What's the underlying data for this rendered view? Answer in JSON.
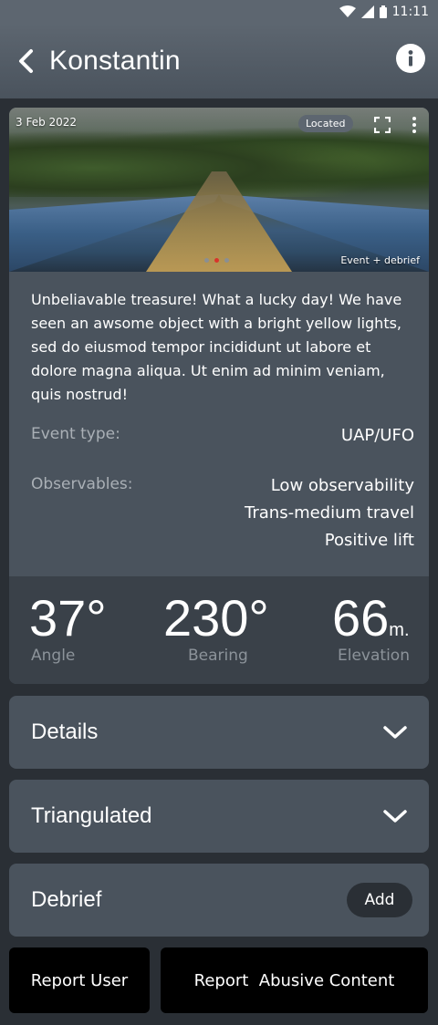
{
  "status_bar": {
    "time": "11:11",
    "icons": [
      "wifi-icon",
      "signal-icon",
      "battery-icon"
    ]
  },
  "header": {
    "title": "Konstantin",
    "back_icon": "chevron-left-icon",
    "info_icon": "info-icon"
  },
  "card": {
    "photo": {
      "date": "3 Feb 2022",
      "badge": "Located",
      "caption": "Event + debrief",
      "carousel": {
        "count": 3,
        "active_index": 1
      }
    },
    "description": "Unbeliavable treasure! What a lucky day! We have seen an awsome object with a bright yellow lights, sed do eiusmod tempor incididunt ut labore et dolore magna aliqua. Ut enim ad minim veniam, quis nostrud!",
    "event_type": {
      "label": "Event type:",
      "value": "UAP/UFO"
    },
    "observables": {
      "label": "Observables:",
      "values": [
        "Low observability",
        "Trans-medium travel",
        "Positive lift"
      ]
    },
    "stats": {
      "angle": {
        "value": "37°",
        "label": "Angle"
      },
      "bearing": {
        "value": "230°",
        "label": "Bearing"
      },
      "elevation": {
        "value": "66",
        "unit": "m.",
        "label": "Elevation"
      }
    }
  },
  "sections": {
    "details": "Details",
    "triangulated": "Triangulated",
    "debrief": "Debrief",
    "debrief_add": "Add"
  },
  "actions": {
    "report_user": "Report User",
    "report_content": "Report  Abusive Content"
  },
  "colors": {
    "background": "#2a2f35",
    "card": "#4a535d",
    "stats_bg": "#3a4149",
    "header": "#5d6670",
    "active_dot": "#d9342b"
  }
}
